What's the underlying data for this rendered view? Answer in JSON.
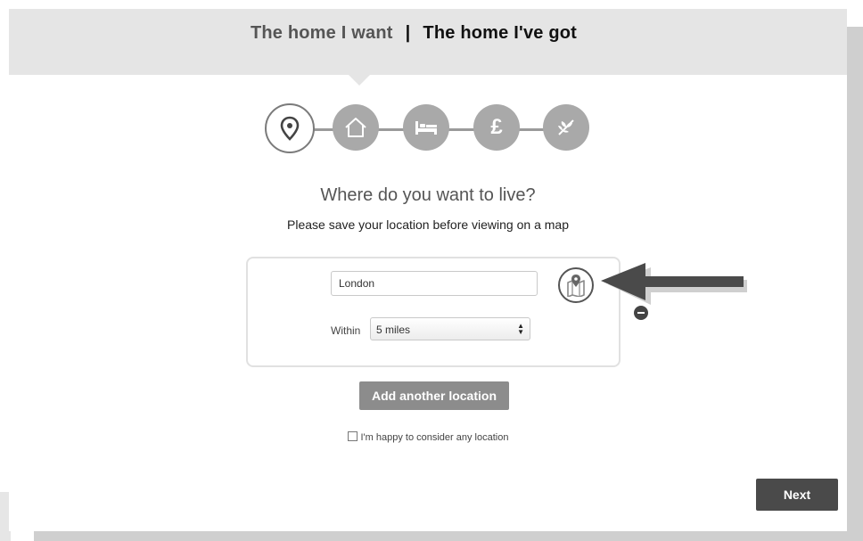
{
  "header": {
    "tab_want": "The home I want",
    "separator": "|",
    "tab_got": "The home I've got"
  },
  "steps": [
    {
      "icon": "location-pin-icon",
      "active": true
    },
    {
      "icon": "house-icon",
      "active": false
    },
    {
      "icon": "bed-icon",
      "active": false
    },
    {
      "icon": "pound-icon",
      "symbol": "£",
      "active": false
    },
    {
      "icon": "leaf-icon",
      "active": false
    }
  ],
  "main": {
    "question": "Where do you want to live?",
    "subtext": "Please save your location before viewing on a map"
  },
  "location": {
    "value": "London",
    "within_label": "Within",
    "radius_selected": "5 miles",
    "map_icon": "map-pin-icon",
    "remove_icon": "minus-circle-icon"
  },
  "actions": {
    "add_location_label": "Add another location",
    "any_location_label": "I'm happy to consider any location",
    "any_location_checked": false,
    "next_label": "Next"
  },
  "colors": {
    "header_background": "#e5e5e5",
    "step_fill": "#a9a9a9",
    "next_button": "#4a4a4a",
    "add_button": "#8c8c8c"
  }
}
